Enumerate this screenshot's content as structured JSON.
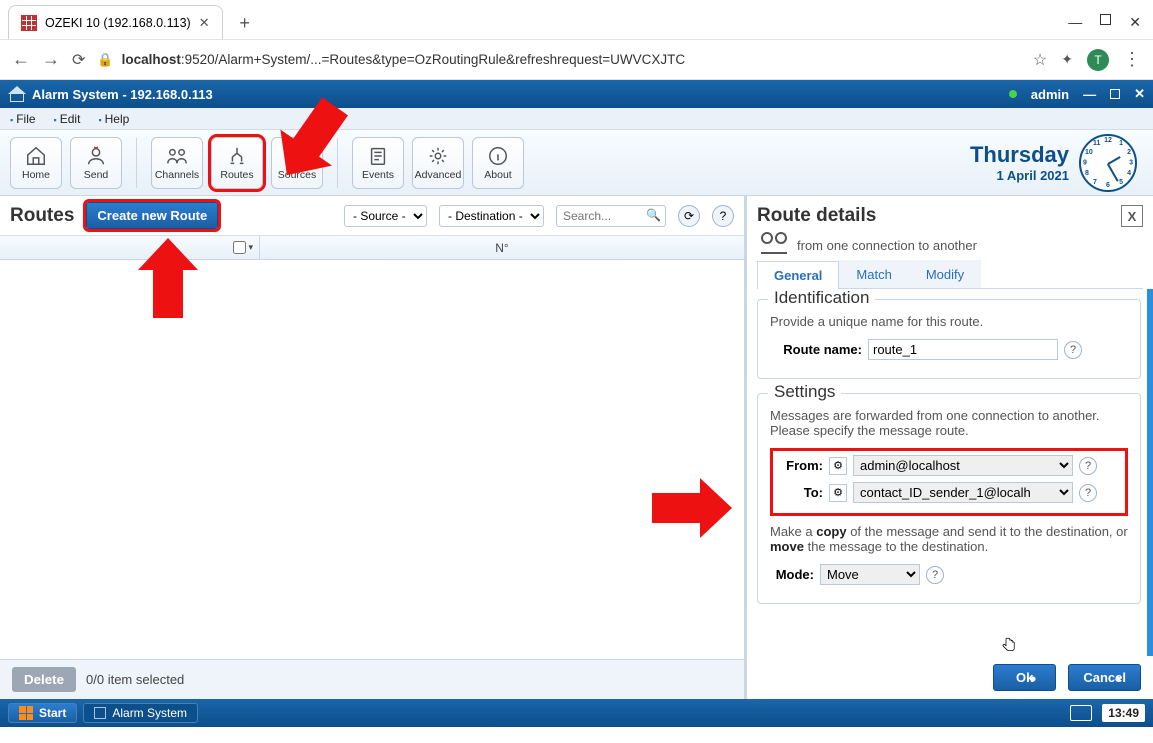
{
  "browser": {
    "tab_title": "OZEKI 10 (192.168.0.113)",
    "url_host": "localhost",
    "url_rest": ":9520/Alarm+System/...=Routes&type=OzRoutingRule&refreshrequest=UWVCXJTC",
    "avatar_letter": "T"
  },
  "app": {
    "title": "Alarm System - 192.168.0.113",
    "user": "admin"
  },
  "menus": {
    "file": "File",
    "edit": "Edit",
    "help": "Help"
  },
  "ribbon": {
    "home": "Home",
    "send": "Send",
    "channels": "Channels",
    "routes": "Routes",
    "sources": "Sources",
    "events": "Events",
    "advanced": "Advanced",
    "about": "About"
  },
  "clock": {
    "day": "Thursday",
    "date": "1 April 2021"
  },
  "routes": {
    "heading": "Routes",
    "create_btn": "Create new Route",
    "source_filter": "- Source - ",
    "dest_filter": "- Destination - ",
    "search_placeholder": "Search...",
    "col_no": "N°",
    "delete_btn": "Delete",
    "selection_text": "0/0 item selected"
  },
  "details": {
    "heading": "Route details",
    "subtitle": "from one connection to another",
    "tabs": {
      "general": "General",
      "match": "Match",
      "modify": "Modify"
    },
    "ident": {
      "legend": "Identification",
      "desc": "Provide a unique name for this route.",
      "name_label": "Route name:",
      "name_value": "route_1"
    },
    "settings": {
      "legend": "Settings",
      "desc": "Messages are forwarded from one connection to another. Please specify the message route.",
      "from_label": "From:",
      "from_value": "admin@localhost",
      "to_label": "To:",
      "to_value": "contact_ID_sender_1@localh",
      "note_pre": "Make a ",
      "note_copy": "copy",
      "note_mid": " of the message and send it to the destination, or ",
      "note_move": "move",
      "note_post": " the message to the destination.",
      "mode_label": "Mode:",
      "mode_value": "Move"
    },
    "ok": "Ok",
    "cancel": "Cancel"
  },
  "taskbar": {
    "start": "Start",
    "app": "Alarm System",
    "time": "13:49"
  }
}
